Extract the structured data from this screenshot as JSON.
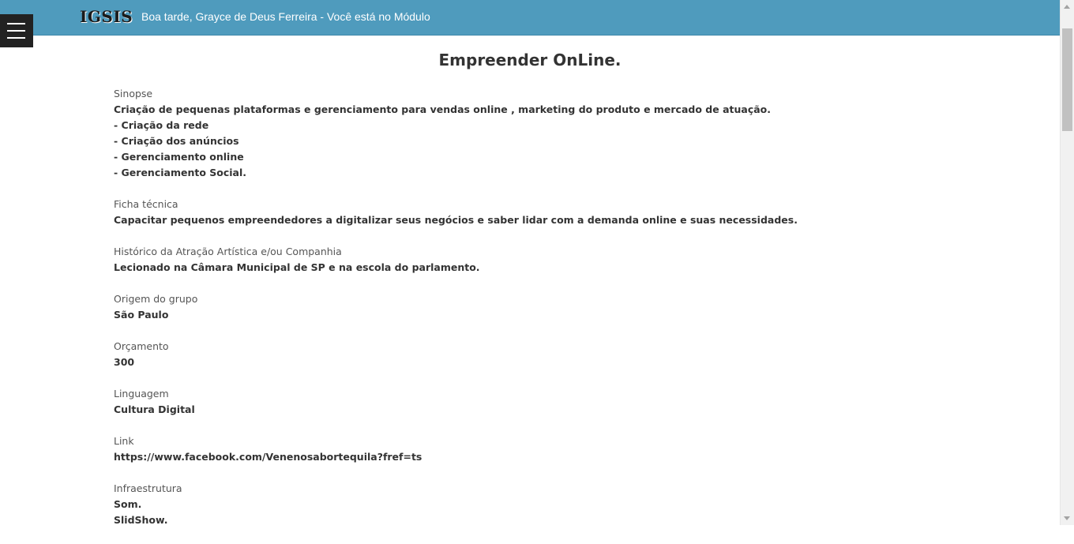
{
  "header": {
    "brand": "IGSIS",
    "greeting": "Boa tarde, Grayce de Deus Ferreira - Você está no Módulo"
  },
  "page": {
    "title": "Empreender OnLine."
  },
  "fields": [
    {
      "label": "Sinopse",
      "values": [
        "Criação de pequenas plataformas e gerenciamento para vendas online , marketing do produto e mercado de atuação.",
        "- Criação da rede",
        "- Criação dos anúncios",
        "- Gerenciamento online",
        "- Gerenciamento Social."
      ]
    },
    {
      "label": "Ficha técnica",
      "values": [
        "Capacitar pequenos empreendedores a digitalizar seus negócios e saber lidar com a demanda online e suas necessidades."
      ]
    },
    {
      "label": "Histórico da Atração Artística e/ou Companhia",
      "values": [
        "Lecionado na Câmara Municipal de SP e na escola do parlamento."
      ]
    },
    {
      "label": "Origem do grupo",
      "values": [
        "São Paulo"
      ]
    },
    {
      "label": "Orçamento",
      "values": [
        "300"
      ]
    },
    {
      "label": "Linguagem",
      "values": [
        "Cultura Digital"
      ]
    },
    {
      "label": "Link",
      "values": [
        "https://www.facebook.com/Venenosabortequila?fref=ts"
      ]
    },
    {
      "label": "Infraestrutura",
      "values": [
        "Som.",
        "SlidShow."
      ]
    }
  ],
  "icons": {
    "menu": "hamburger-menu-icon"
  }
}
